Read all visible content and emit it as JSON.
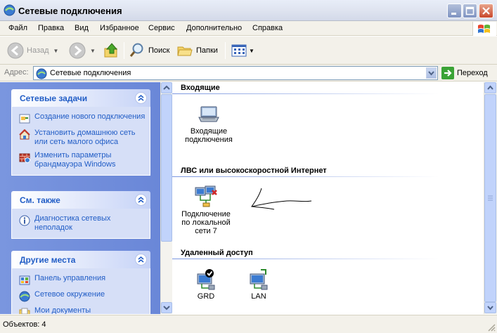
{
  "window": {
    "title": "Сетевые подключения"
  },
  "menu": {
    "items": [
      "Файл",
      "Правка",
      "Вид",
      "Избранное",
      "Сервис",
      "Дополнительно",
      "Справка"
    ]
  },
  "toolbar": {
    "back_label": "Назад",
    "search_label": "Поиск",
    "folders_label": "Папки"
  },
  "address": {
    "label": "Адрес:",
    "value": "Сетевые подключения",
    "go_label": "Переход"
  },
  "left_panels": [
    {
      "title": "Сетевые задачи",
      "tasks": [
        {
          "icon": "new-connection-icon",
          "label": "Создание нового подключения"
        },
        {
          "icon": "home-network-icon",
          "label": "Установить домашнюю сеть или сеть малого офиса"
        },
        {
          "icon": "firewall-icon",
          "label": "Изменить параметры брандмауэра Windows"
        }
      ]
    },
    {
      "title": "См. также",
      "tasks": [
        {
          "icon": "info-icon",
          "label": "Диагностика сетевых неполадок"
        }
      ]
    },
    {
      "title": "Другие места",
      "tasks": [
        {
          "icon": "control-panel-icon",
          "label": "Панель управления"
        },
        {
          "icon": "network-places-icon",
          "label": "Сетевое окружение"
        },
        {
          "icon": "my-documents-icon",
          "label": "Мои документы"
        }
      ]
    }
  ],
  "groups": [
    {
      "title": "Входящие",
      "items": [
        {
          "label": "Входящие подключения",
          "icon": "incoming-connections-icon"
        }
      ]
    },
    {
      "title": "ЛВС или высокоскоростной Интернет",
      "items": [
        {
          "label": "Подключение по локальной сети 7",
          "icon": "lan-connection-icon"
        }
      ]
    },
    {
      "title": "Удаленный доступ",
      "items": [
        {
          "label": "GRD",
          "icon": "dialup-default-icon"
        },
        {
          "label": "LAN",
          "icon": "dialup-icon"
        }
      ]
    }
  ],
  "status": {
    "text": "Объектов: 4"
  },
  "colors": {
    "task_link": "#215dc6",
    "left_pane": "#7a96df",
    "panel_body": "#d6dff7"
  }
}
